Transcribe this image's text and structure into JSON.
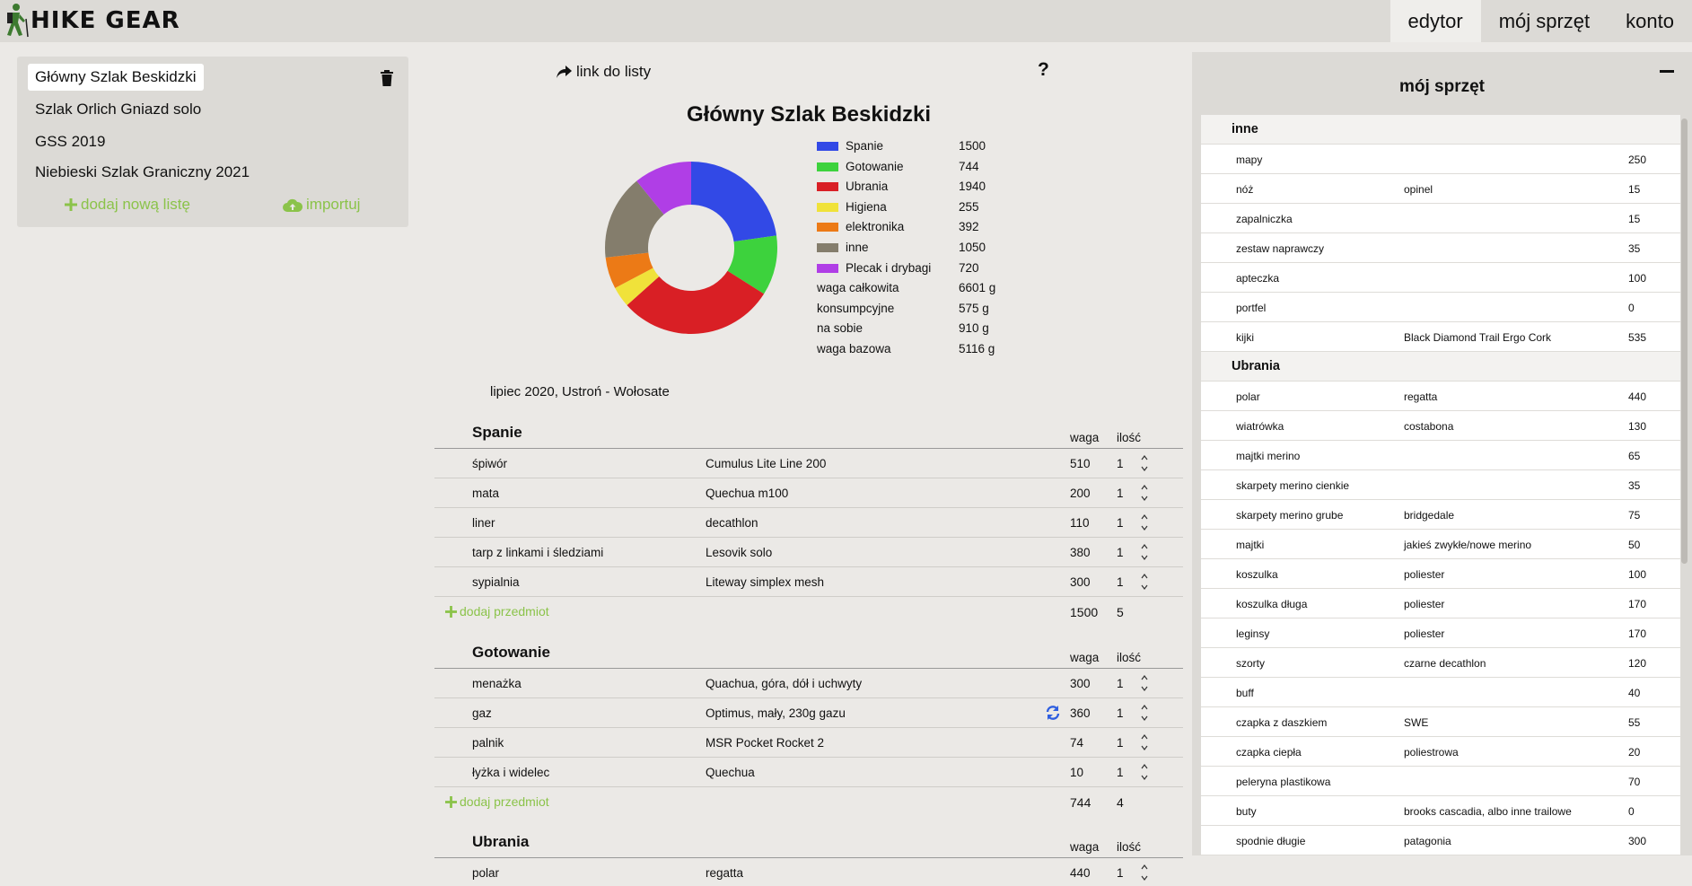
{
  "app": {
    "logo_text": "HIKE GEAR"
  },
  "nav": {
    "items": [
      "edytor",
      "mój sprzęt",
      "konto"
    ],
    "active": "edytor"
  },
  "lists": {
    "items": [
      "Główny Szlak Beskidzki",
      "Szlak Orlich Gniazd solo",
      "GSS 2019",
      "Niebieski Szlak Graniczny 2021"
    ],
    "active_index": 0,
    "add_label": "dodaj nową listę",
    "import_label": "importuj"
  },
  "editor": {
    "link_label": "link do listy",
    "help": "?",
    "title": "Główny Szlak Beskidzki",
    "description": "lipiec 2020, Ustroń - Wołosate",
    "col_weight": "waga",
    "col_qty": "ilość",
    "add_item_label": "dodaj przedmiot"
  },
  "chart_data": {
    "type": "pie",
    "variant": "donut",
    "categories": [
      "Spanie",
      "Gotowanie",
      "Ubrania",
      "Higiena",
      "elektronika",
      "inne",
      "Plecak i drybagi"
    ],
    "values": [
      1500,
      744,
      1940,
      255,
      392,
      1050,
      720
    ],
    "colors": [
      "#3249e6",
      "#3dd23d",
      "#d91f25",
      "#f0e23a",
      "#ec7a16",
      "#847d6c",
      "#b03ee6"
    ],
    "legend_position": "right"
  },
  "summary": [
    {
      "label": "waga całkowita",
      "value": "6601 g"
    },
    {
      "label": "konsumpcyjne",
      "value": "575 g"
    },
    {
      "label": "na sobie",
      "value": "910 g"
    },
    {
      "label": "waga bazowa",
      "value": "5116 g"
    }
  ],
  "categories": [
    {
      "name": "Spanie",
      "items": [
        {
          "name": "śpiwór",
          "desc": "Cumulus Lite Line 200",
          "weight": "510",
          "qty": "1"
        },
        {
          "name": "mata",
          "desc": "Quechua m100",
          "weight": "200",
          "qty": "1"
        },
        {
          "name": "liner",
          "desc": "decathlon",
          "weight": "110",
          "qty": "1"
        },
        {
          "name": "tarp z linkami i śledziami",
          "desc": "Lesovik solo",
          "weight": "380",
          "qty": "1"
        },
        {
          "name": "sypialnia",
          "desc": "Liteway simplex mesh",
          "weight": "300",
          "qty": "1"
        }
      ],
      "total_weight": "1500",
      "total_qty": "5"
    },
    {
      "name": "Gotowanie",
      "items": [
        {
          "name": "menażka",
          "desc": "Quachua, góra, dół i uchwyty",
          "weight": "300",
          "qty": "1"
        },
        {
          "name": "gaz",
          "desc": "Optimus, mały, 230g gazu",
          "weight": "360",
          "qty": "1",
          "consumable": true
        },
        {
          "name": "palnik",
          "desc": "MSR Pocket Rocket 2",
          "weight": "74",
          "qty": "1"
        },
        {
          "name": "łyżka i widelec",
          "desc": "Quechua",
          "weight": "10",
          "qty": "1"
        }
      ],
      "total_weight": "744",
      "total_qty": "4"
    },
    {
      "name": "Ubrania",
      "items": [
        {
          "name": "polar",
          "desc": "regatta",
          "weight": "440",
          "qty": "1"
        }
      ]
    }
  ],
  "gear": {
    "title": "mój sprzęt",
    "groups": [
      {
        "name": "inne",
        "items": [
          {
            "name": "mapy",
            "desc": "",
            "weight": "250"
          },
          {
            "name": "nóż",
            "desc": "opinel",
            "weight": "15"
          },
          {
            "name": "zapalniczka",
            "desc": "",
            "weight": "15"
          },
          {
            "name": "zestaw naprawczy",
            "desc": "",
            "weight": "35"
          },
          {
            "name": "apteczka",
            "desc": "",
            "weight": "100"
          },
          {
            "name": "portfel",
            "desc": "",
            "weight": "0"
          },
          {
            "name": "kijki",
            "desc": "Black Diamond Trail Ergo Cork",
            "weight": "535"
          }
        ]
      },
      {
        "name": "Ubrania",
        "items": [
          {
            "name": "polar",
            "desc": "regatta",
            "weight": "440"
          },
          {
            "name": "wiatrówka",
            "desc": "costabona",
            "weight": "130"
          },
          {
            "name": "majtki merino",
            "desc": "",
            "weight": "65"
          },
          {
            "name": "skarpety merino cienkie",
            "desc": "",
            "weight": "35"
          },
          {
            "name": "skarpety merino grube",
            "desc": "bridgedale",
            "weight": "75"
          },
          {
            "name": "majtki",
            "desc": "jakieś zwykłe/nowe merino",
            "weight": "50"
          },
          {
            "name": "koszulka",
            "desc": "poliester",
            "weight": "100"
          },
          {
            "name": "koszulka długa",
            "desc": "poliester",
            "weight": "170"
          },
          {
            "name": "leginsy",
            "desc": "poliester",
            "weight": "170"
          },
          {
            "name": "szorty",
            "desc": "czarne decathlon",
            "weight": "120"
          },
          {
            "name": "buff",
            "desc": "",
            "weight": "40"
          },
          {
            "name": "czapka z daszkiem",
            "desc": "SWE",
            "weight": "55"
          },
          {
            "name": "czapka ciepła",
            "desc": "poliestrowa",
            "weight": "20"
          },
          {
            "name": "peleryna plastikowa",
            "desc": "",
            "weight": "70"
          },
          {
            "name": "buty",
            "desc": "brooks cascadia, albo inne trailowe",
            "weight": "0"
          },
          {
            "name": "spodnie długie",
            "desc": "patagonia",
            "weight": "300"
          }
        ]
      }
    ]
  }
}
